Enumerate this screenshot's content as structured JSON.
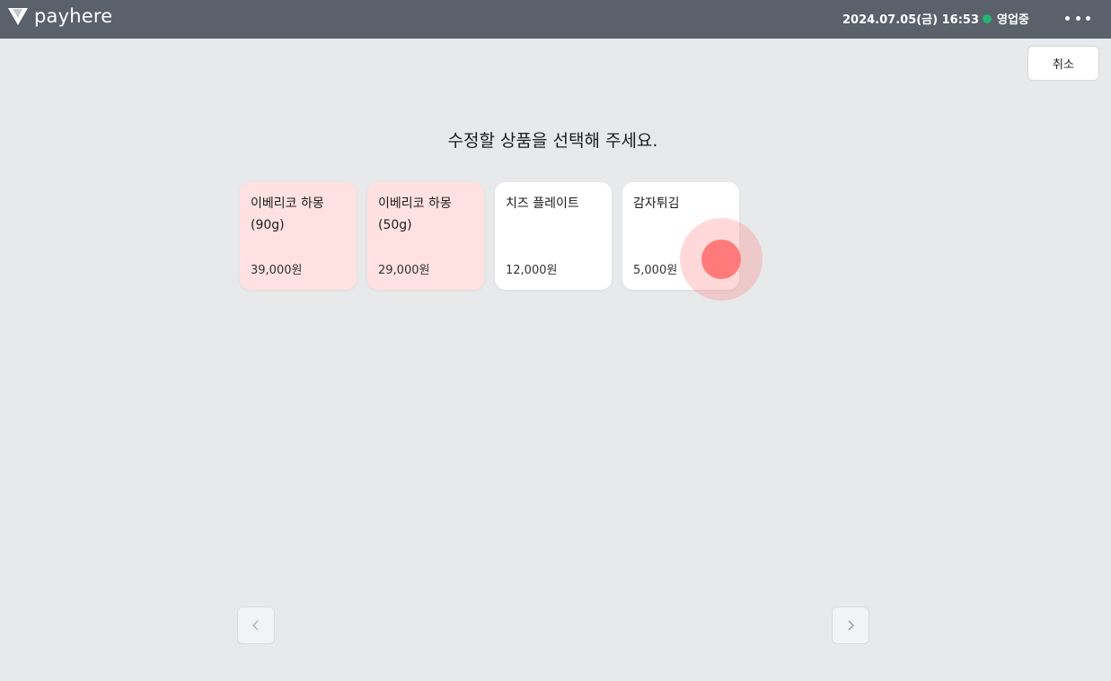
{
  "header": {
    "logo_text": "payhere",
    "datetime": "2024.07.05(금) 16:53",
    "status_label": "영업중",
    "status_color": "#22b573"
  },
  "actions": {
    "cancel_label": "취소"
  },
  "main": {
    "heading": "수정할 상품을 선택해 주세요.",
    "products": [
      {
        "name_line1": "이베리코 하몽",
        "name_line2": "(90g)",
        "price": "39,000원",
        "bg": "#ffe1e1"
      },
      {
        "name_line1": "이베리코 하몽",
        "name_line2": "(50g)",
        "price": "29,000원",
        "bg": "#ffe1e1"
      },
      {
        "name_line1": "치즈 플레이트",
        "name_line2": "",
        "price": "12,000원",
        "bg": "#ffffff"
      },
      {
        "name_line1": "감자튀김",
        "name_line2": "",
        "price": "5,000원",
        "bg": "#ffffff"
      }
    ]
  },
  "pagination": {
    "prev_icon": "chevron-left-icon",
    "next_icon": "chevron-right-icon"
  }
}
